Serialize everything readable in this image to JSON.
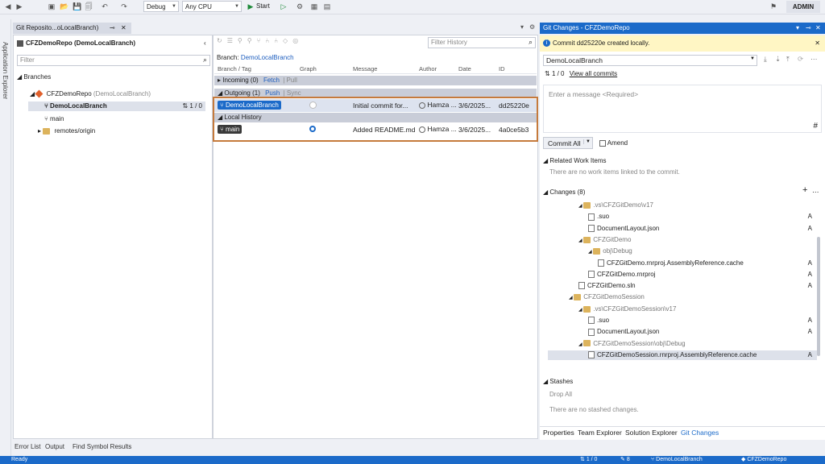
{
  "toolbar": {
    "config": "Debug",
    "platform": "Any CPU",
    "start": "Start",
    "user": "ADMIN"
  },
  "side_strip": "Application Explorer",
  "repo_panel": {
    "tab_title": "Git Reposito...oLocalBranch)",
    "repo_title": "CFZDemoRepo (DemoLocalBranch)",
    "filter_placeholder": "Filter",
    "branches_label": "Branches",
    "repo_node": "CFZDemoRepo",
    "repo_node_branch": "(DemoLocalBranch)",
    "current_branch": "DemoLocalBranch",
    "current_branch_sync": "1 / 0",
    "main_branch": "main",
    "remotes": "remotes/origin"
  },
  "history_panel": {
    "filter_placeholder": "Filter History",
    "branch_label": "Branch:",
    "branch_value": "DemoLocalBranch",
    "columns": [
      "Branch / Tag",
      "Graph",
      "Message",
      "Author",
      "Date",
      "ID"
    ],
    "incoming": "Incoming (0)",
    "fetch": "Fetch",
    "pull": "Pull",
    "outgoing": "Outgoing (1)",
    "push": "Push",
    "sync": "Sync",
    "local_history": "Local History",
    "commits": [
      {
        "tag": "DemoLocalBranch",
        "message": "Initial commit for...",
        "author": "Hamza ...",
        "date": "3/6/2025...",
        "id": "dd25220e"
      },
      {
        "tag": "main",
        "message": "Added README.md",
        "author": "Hamza ...",
        "date": "3/6/2025...",
        "id": "4a0ce5b3"
      }
    ]
  },
  "bottom_tabs": [
    "Error List",
    "Output",
    "Find Symbol Results"
  ],
  "status_bar": {
    "ready": "Ready",
    "sync": "1 / 0",
    "changes": "8",
    "branch": "DemoLocalBranch",
    "repo": "CFZDemoRepo"
  },
  "git_changes": {
    "title": "Git Changes - CFZDemoRepo",
    "info": "Commit dd25220e created locally.",
    "branch": "DemoLocalBranch",
    "sync": "1 / 0",
    "view_all": "View all commits",
    "message_placeholder": "Enter a message <Required>",
    "commit_all": "Commit All",
    "amend": "Amend",
    "related_work_items": "Related Work Items",
    "no_work_items": "There are no work items linked to the commit.",
    "changes_label": "Changes (8)",
    "tree": [
      {
        "label": ".vs\\CFZGitDemo\\v17",
        "type": "folder",
        "indent": 1,
        "status": ""
      },
      {
        "label": ".suo",
        "type": "file",
        "indent": 2,
        "status": "A"
      },
      {
        "label": "DocumentLayout.json",
        "type": "file",
        "indent": 2,
        "status": "A"
      },
      {
        "label": "CFZGitDemo",
        "type": "folder",
        "indent": 1,
        "status": ""
      },
      {
        "label": "obj\\Debug",
        "type": "folder",
        "indent": 2,
        "status": ""
      },
      {
        "label": "CFZGitDemo.rnrproj.AssemblyReference.cache",
        "type": "file",
        "indent": 3,
        "status": "A"
      },
      {
        "label": "CFZGitDemo.rnrproj",
        "type": "file",
        "indent": 2,
        "status": "A"
      },
      {
        "label": "CFZGitDemo.sln",
        "type": "file",
        "indent": 1,
        "status": "A"
      },
      {
        "label": "CFZGitDemoSession",
        "type": "folder",
        "indent": 0,
        "status": ""
      },
      {
        "label": ".vs\\CFZGitDemoSession\\v17",
        "type": "folder",
        "indent": 1,
        "status": ""
      },
      {
        "label": ".suo",
        "type": "file",
        "indent": 2,
        "status": "A"
      },
      {
        "label": "DocumentLayout.json",
        "type": "file",
        "indent": 2,
        "status": "A"
      },
      {
        "label": "CFZGitDemoSession\\obj\\Debug",
        "type": "folder",
        "indent": 1,
        "status": ""
      },
      {
        "label": "CFZGitDemoSession.rnrproj.AssemblyReference.cache",
        "type": "file",
        "indent": 2,
        "status": "A"
      }
    ],
    "stashes": "Stashes",
    "drop_all": "Drop All",
    "no_stashes": "There are no stashed changes.",
    "bottom_tabs": [
      "Properties",
      "Team Explorer",
      "Solution Explorer",
      "Git Changes"
    ]
  }
}
